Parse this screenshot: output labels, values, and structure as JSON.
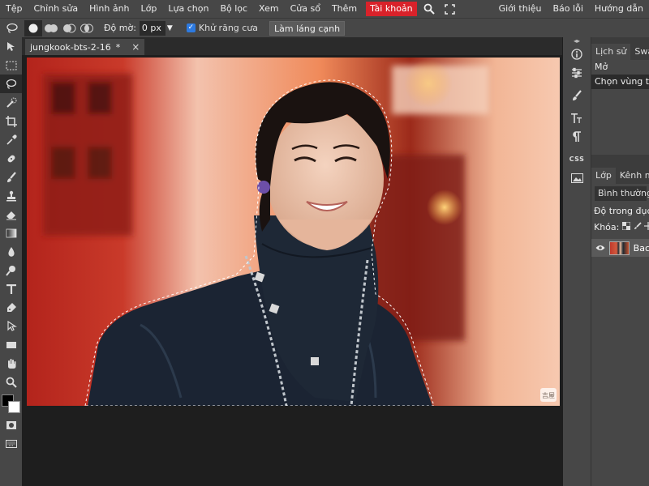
{
  "menu": {
    "items": [
      "Tệp",
      "Chỉnh sửa",
      "Hình ảnh",
      "Lớp",
      "Lựa chọn",
      "Bộ lọc",
      "Xem",
      "Cửa sổ",
      "Thêm"
    ],
    "account": "Tài khoản",
    "right": [
      "Giới thiệu",
      "Báo lỗi",
      "Hướng dẫn"
    ]
  },
  "options": {
    "feather_label": "Độ mờ:",
    "feather_value": "0 px",
    "antialias_label": "Khử răng cưa",
    "refine_button": "Làm láng cạnh"
  },
  "document": {
    "tab_title": "jungkook-bts-2-16",
    "tab_modified": "*",
    "close": "×",
    "watermark": "吉屋"
  },
  "panels": {
    "top_tabs": [
      "Lịch sử",
      "Swat"
    ],
    "history": [
      "Mở",
      "Chọn vùng tự c"
    ],
    "layer_tabs": [
      "Lớp",
      "Kênh m"
    ],
    "blend_mode": "Bình thường",
    "opacity_label": "Độ trong đục:",
    "lock_label": "Khóa:",
    "layer_name": "Bac"
  },
  "colors": {
    "accent": "#d9222a",
    "panel": "#474747",
    "workspace": "#1e1e1e",
    "foreground_swatch": "#000000",
    "background_swatch": "#ffffff"
  }
}
